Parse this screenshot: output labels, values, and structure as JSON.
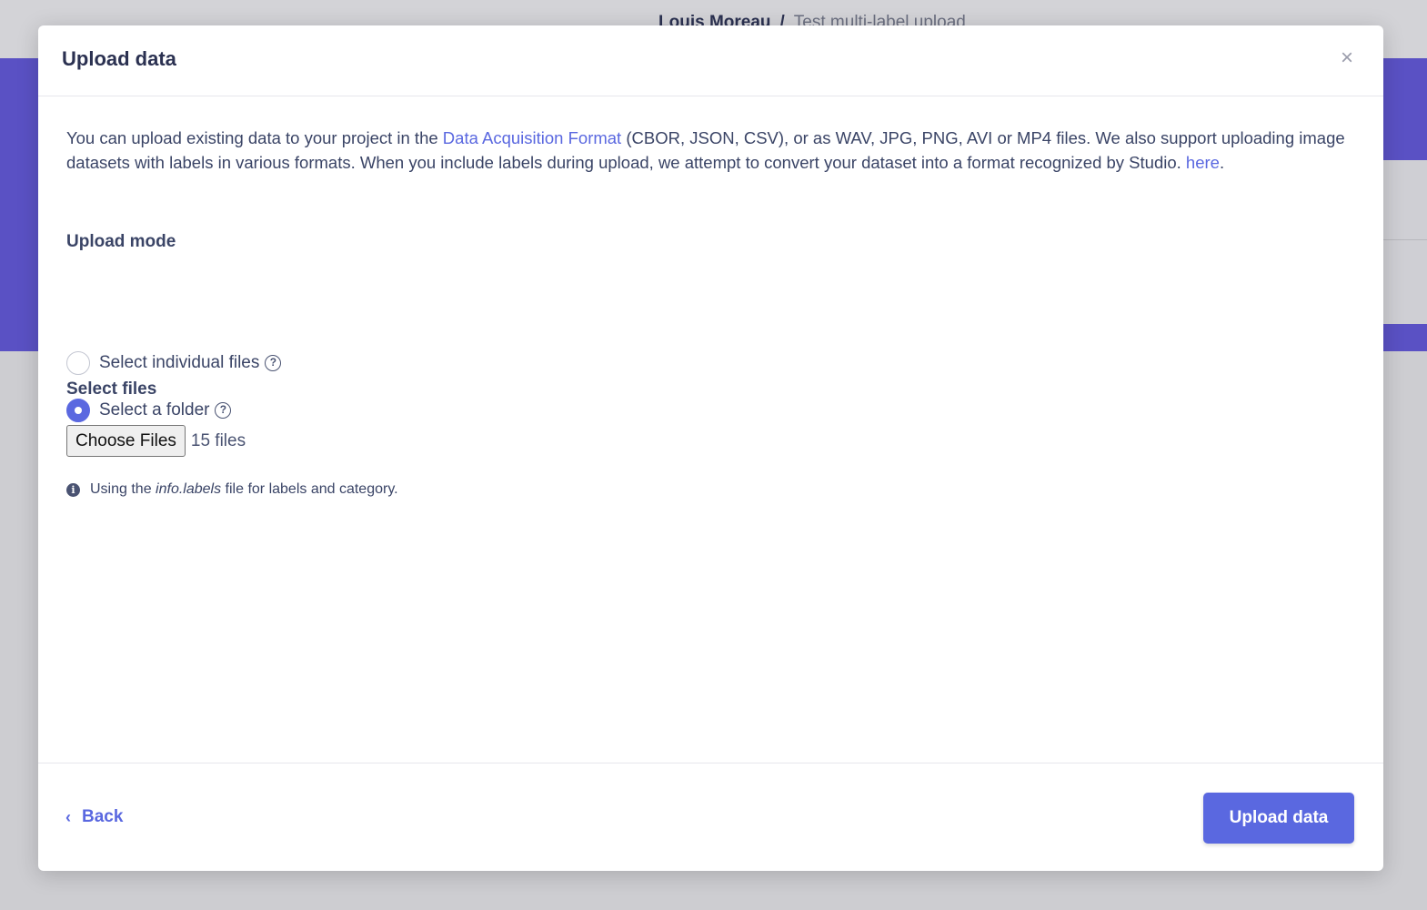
{
  "background": {
    "breadcrumb_owner": "Louis Moreau",
    "breadcrumb_separator": "/",
    "breadcrumb_project": "Test multi-label upload"
  },
  "modal": {
    "title": "Upload data",
    "close_icon": "×",
    "intro": {
      "part1": "You can upload existing data to your project in the ",
      "link1": "Data Acquisition Format",
      "part2": " (CBOR, JSON, CSV), or as WAV, JPG, PNG, AVI or MP4 files. We also support uploading image datasets with labels in various formats. When you include labels during upload, we attempt to convert your dataset into a format recognized by Studio. ",
      "link2": "here",
      "part3": "."
    },
    "upload_mode": {
      "label": "Upload mode",
      "options": [
        {
          "label": "Select individual files",
          "selected": false
        },
        {
          "label": "Select a folder",
          "selected": true
        }
      ],
      "help_glyph": "?"
    },
    "select_files": {
      "label": "Select files",
      "button_label": "Choose Files",
      "file_count": "15 files"
    },
    "info": {
      "icon_glyph": "i",
      "prefix": "Using the ",
      "filename": "info.labels",
      "suffix": " file for labels and category."
    },
    "footer": {
      "back_label": "Back",
      "back_chevron": "‹",
      "upload_label": "Upload data"
    }
  },
  "colors": {
    "accent": "#5a68e0",
    "hero": "#5a51c4",
    "text": "#3a4466"
  }
}
